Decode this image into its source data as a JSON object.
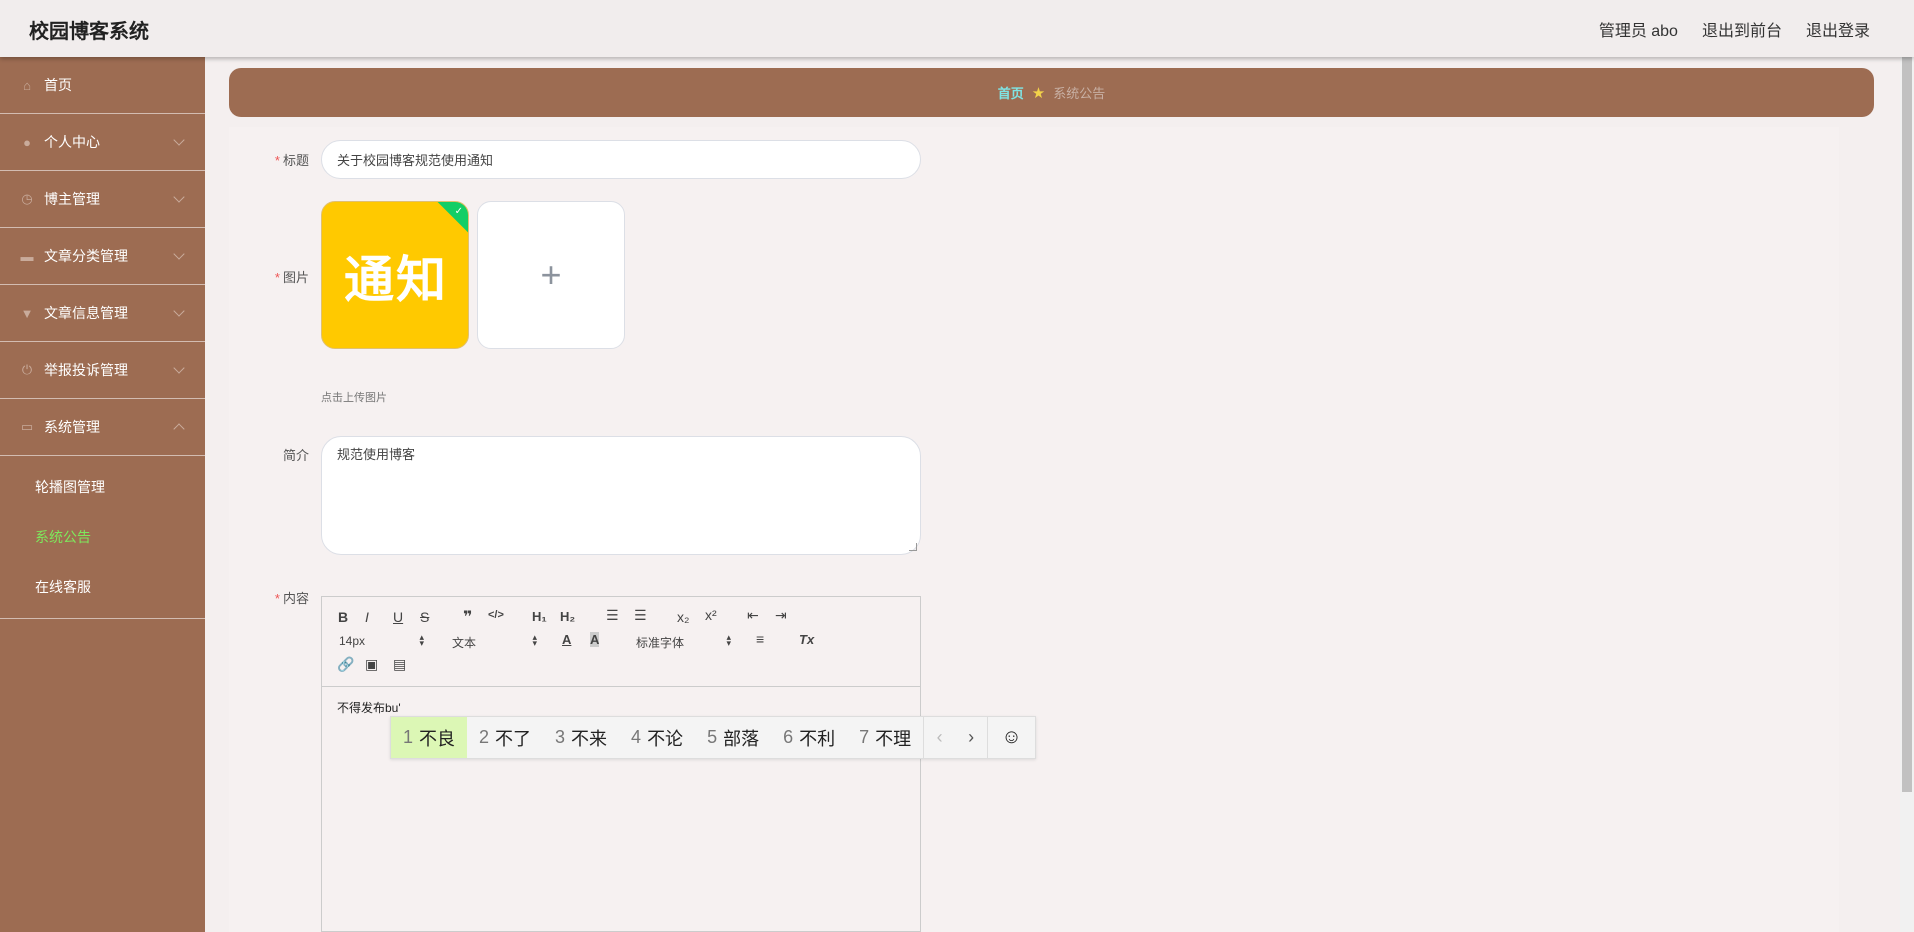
{
  "header": {
    "brand": "校园博客系统",
    "links": [
      "管理员 abo",
      "退出到前台",
      "退出登录"
    ]
  },
  "sidebar": {
    "items": [
      {
        "label": "首页",
        "icon": "home-icon"
      },
      {
        "label": "个人中心",
        "icon": "user-icon"
      },
      {
        "label": "博主管理",
        "icon": "clock-icon"
      },
      {
        "label": "文章分类管理",
        "icon": "ticket-icon"
      },
      {
        "label": "文章信息管理",
        "icon": "pin-icon"
      },
      {
        "label": "举报投诉管理",
        "icon": "power-icon"
      },
      {
        "label": "系统管理",
        "icon": "chat-icon"
      }
    ],
    "submenu": [
      {
        "label": "轮播图管理"
      },
      {
        "label": "系统公告",
        "active": true
      },
      {
        "label": "在线客服"
      }
    ]
  },
  "breadcrumb": {
    "home": "首页",
    "current": "系统公告"
  },
  "form": {
    "title_label": "标题",
    "title_value": "关于校园博客规范使用通知",
    "image_label": "图片",
    "image_text": "通知",
    "add_symbol": "+",
    "upload_tip": "点击上传图片",
    "intro_label": "简介",
    "intro_value": "规范使用博客",
    "content_label": "内容",
    "content_value": "不得发布bu'"
  },
  "toolbar": {
    "font_size": "14px",
    "header_select": "文本",
    "font_family": "标准字体"
  },
  "ime": {
    "candidates": [
      {
        "num": "1",
        "text": "不良"
      },
      {
        "num": "2",
        "text": "不了"
      },
      {
        "num": "3",
        "text": "不来"
      },
      {
        "num": "4",
        "text": "不论"
      },
      {
        "num": "5",
        "text": "部落"
      },
      {
        "num": "6",
        "text": "不利"
      },
      {
        "num": "7",
        "text": "不理"
      }
    ],
    "emoji": "☺"
  },
  "colors": {
    "sidebar": "#9d6c52",
    "active_submenu": "#7ee85c",
    "breadcrumb_home": "#7fe4e4"
  }
}
